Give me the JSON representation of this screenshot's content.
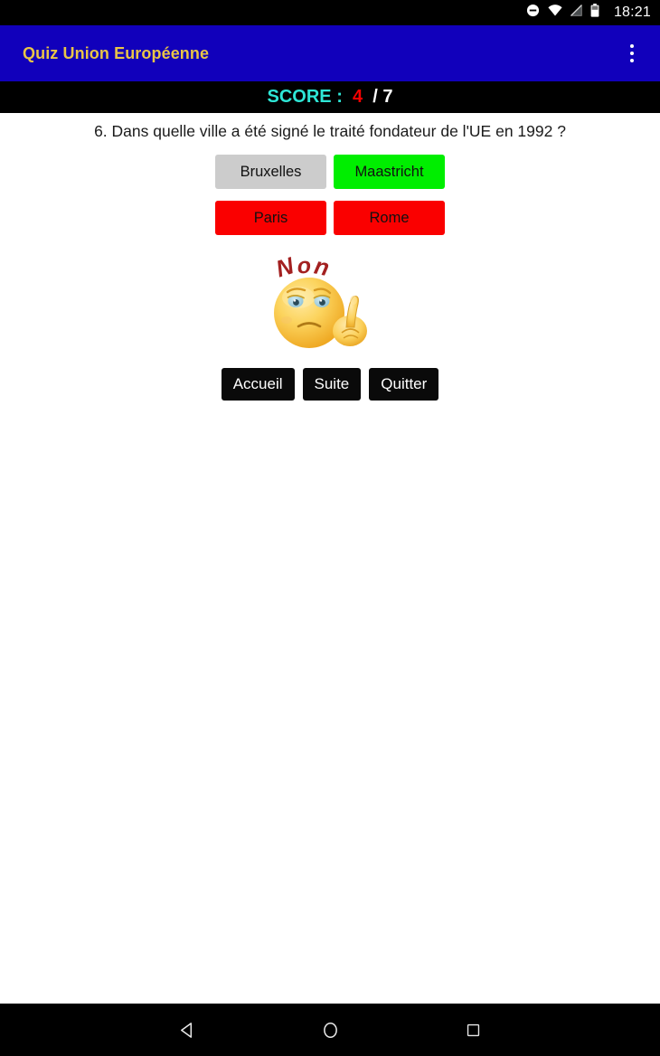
{
  "status_bar": {
    "icons": [
      "do-not-disturb-icon",
      "wifi-icon",
      "signal-off-icon",
      "battery-icon"
    ],
    "time": "18:21"
  },
  "app_bar": {
    "title": "Quiz Union Européenne",
    "overflow_icon": "more-vertical-icon",
    "background": "#1100bb",
    "title_color": "#e8c547"
  },
  "score_bar": {
    "label": "SCORE :",
    "value": "4",
    "separator": "/",
    "total": "7",
    "label_color": "#2ee6d6",
    "value_color": "#f40000",
    "total_color": "#ffffff"
  },
  "quiz": {
    "question_number": "6.",
    "question": "6. Dans quelle ville a été signé le traité fondateur de l'UE en 1992 ?",
    "answers": [
      {
        "label": "Bruxelles",
        "state": "neutral",
        "color": "#cccccc"
      },
      {
        "label": "Maastricht",
        "state": "correct",
        "color": "#00ee00"
      },
      {
        "label": "Paris",
        "state": "wrong",
        "color": "#fa0000"
      },
      {
        "label": "Rome",
        "state": "wrong",
        "color": "#fa0000"
      }
    ],
    "feedback": {
      "icon": "sad-smiley-wagging-finger-icon",
      "text": "Non",
      "text_color": "#a32020",
      "face_color": "#f5c84a"
    }
  },
  "actions": [
    {
      "label": "Accueil"
    },
    {
      "label": "Suite"
    },
    {
      "label": "Quitter"
    }
  ],
  "nav_bar": {
    "back": "back-triangle-icon",
    "home": "home-circle-icon",
    "recents": "recents-square-icon"
  }
}
